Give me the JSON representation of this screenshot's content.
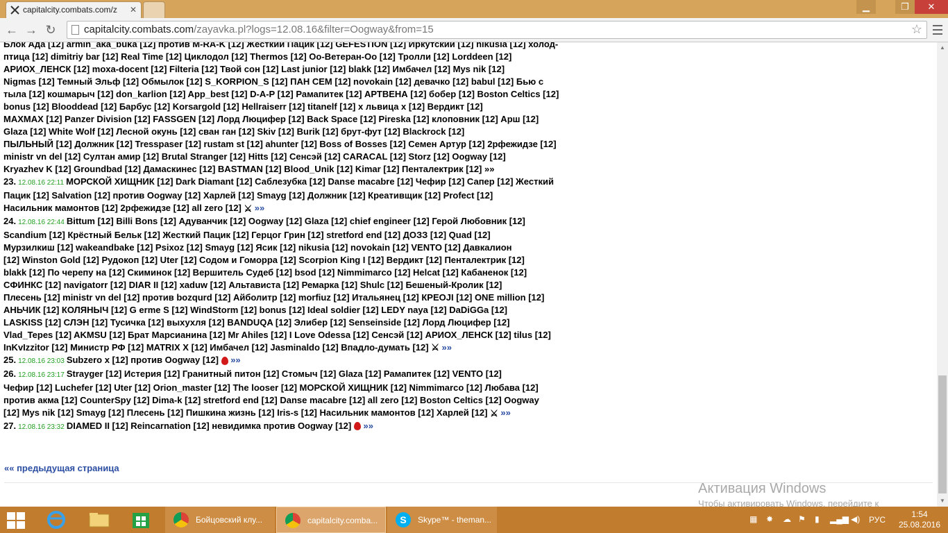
{
  "browser": {
    "tab_title": "capitalcity.combats.com/z",
    "url_host": "capitalcity.combats.com",
    "url_path": "/zayavka.pl?logs=12.08.16&filter=Oogway&from=15"
  },
  "log": {
    "lines": [
      "Блок Ада [12] armin_aka_buka [12] против M-RA-K [12] Жесткий Пацик [12] GEFESTION [12] Иркутский [12] nikusia [12] холод-",
      "птица [12] dimitriy bar [12] Real Time [12] Циклодол [12] Thermos [12] Оо-Ветеран-Оо [12] Тролли [12] Lorddeen [12]",
      "АРИОХ_ЛЕНСК [12] moxa-docent [12] Filteria [12] Твой сон [12] Last junior [12] blakk [12] Имбачел [12] Mys nik [12]",
      "Nigmas [12] Темный Эльф [12] Обмылок [12] S_KORPION_S [12] ПАН СЕМ [12] novokain [12] девачко [12] babul [12] Бью с",
      "тыла [12] кошмарыч [12] don_karlion [12] App_best [12] D-A-P [12] Рамапитек [12] АРТВЕНА [12] бобер [12] Boston Celtics [12]",
      "bonus [12] Blooddead [12] Барбус [12] Korsargold [12] Hellraiserr [12] titanelf [12] х львица х [12] Вердикт [12]",
      "MAXMAX [12] Panzer Division [12] FASSGEN [12] Лорд Люцифер [12] Back Space [12] Pireska [12] клоповник [12] Арш [12]",
      "Glaza [12] White Wolf [12] Лесной окунь [12] сван ган [12] Skiv [12] Burik [12] брут-фут [12] Blackrock [12]",
      "ПЫЛЬНЫЙ [12] Должник [12] Tresspaser [12] rustam st [12] ahunter [12] Boss of Bosses [12] Семен Артур [12] 2рфежидзе [12]",
      "ministr vn del [12] Султан амир [12] Brutal Stranger [12] Hitts [12] Сенсэй [12] CARACAL [12] Storz [12] Oogway [12]",
      "Kryazhev K [12] Groundbad [12] Дамаскинес [12] BASTMAN [12] Blood_Unik [12] Kimar [12] Пенталектрик [12] »»"
    ],
    "entries": [
      {
        "num": "23.",
        "time": "12.08.16 22:11",
        "text1": "МОРСКОЙ ХИЩНИК [12] Dark Diamant [12] Саблезубка [12] Danse macabre [12] Чефир [12] Сапер [12] Жесткий",
        "text2": "Пацик [12] Salvation [12] против Oogway [12] Харлей [12] Smayg [12] Должник [12] Креативщик [12] Profect [12]",
        "text3": "Насильник мамонтов [12] 2рфежидзе [12] all zero [12]",
        "more": "»»"
      },
      {
        "num": "24.",
        "time": "12.08.16 22:44",
        "text1": "Bittum [12] Billi Bons [12] Адуванчик [12] Oogway [12] Glaza [12] chief engineer [12] Герой Любовник [12]",
        "text2": "Scandium [12] Крёстный Бельк [12] Жесткий Пацик [12] Герцог Грин [12] stretford end [12] ДОЗЗ [12] Quad [12]",
        "text3": "Мурзилкиш [12] wakeandbake [12] Psixoz [12] Smayg [12] Ясик [12] nikusia [12] novokain [12] VENTO [12] Давкалион",
        "text4": "[12] Winston Gold [12] Рудокоп [12] Uter [12] Содом и Гоморра [12] Scorpion King I [12] Вердикт [12] Пенталектрик [12]",
        "text5": "blakk [12] По черепу на [12] Скиминок [12] Вершитель Судеб [12] bsod [12] Nimmimarco [12] Helcat [12] Кабаненок [12]",
        "text6": "СФИНКС [12] navigatorr [12] DIAR II [12] xaduw [12] Альтависта [12] Ремарка [12] Shulc [12] Бешеный-Кролик [12]",
        "text7": "Плесень [12] ministr vn del [12] против bozqurd [12] Айболитр [12] morfiuz [12] Итальянец [12] КРЕОJI [12] ONE million [12]",
        "text8": "АНЬЧИК [12] КОЛЯНЫЧ [12] G erme S [12] WindStorm [12] bonus [12] Ideal soldier [12] LEDY naya [12] DaDiGGa [12]",
        "text9": "LASKISS [12] СЛЭН [12] Тусичка [12] выхухля [12] BANDUQA [12] Элибер [12] Senseinside [12] Лорд Люцифер [12]",
        "text10": "Vlad_Tepes [12] AKMSU [12] Брат Марсианина [12] Mr Ahiles [12] I Love Odessa [12] Сенсэй [12] АРИОХ_ЛЕНСК [12] tilus [12]",
        "text11": "InKvIzzitor [12] Министр РФ [12] MATRIX X [12] Имбачел [12] Jasminaldo [12] Впадло-думать [12]",
        "more": "»»"
      },
      {
        "num": "25.",
        "time": "12.08.16 23:03",
        "text1": "Subzero x [12] против Oogway [12]",
        "more": "»»"
      },
      {
        "num": "26.",
        "time": "12.08.16 23:17",
        "text1": "Strayger [12] Истерия [12] Гранитный питон [12] Стомыч [12] Glaza [12] Рамапитек [12] VENTO [12]",
        "text2": "Чефир [12] Luchefer [12] Uter [12] Orion_master [12] The looser [12] МОРСКОЙ ХИЩНИК [12] Nimmimarco [12] Любава [12]",
        "text3": "против акма [12] CounterSpy [12] Dima-k [12] stretford end [12] Danse macabre [12] all zero [12] Boston Celtics [12] Oogway",
        "text4": "[12] Mys nik [12] Smayg [12] Плесень [12] Пишкина жизнь [12] Iris-s [12] Насильник мамонтов [12] Харлей [12]",
        "more": "»»"
      },
      {
        "num": "27.",
        "time": "12.08.16 23:32",
        "text1": "DIAMED II [12] Reincarnation [12] невидимка против Oogway [12]",
        "more": "»»"
      }
    ],
    "prev_page": "«« предыдущая страница"
  },
  "watermark": {
    "title": "Активация Windows",
    "text": "Чтобы активировать Windows, перейдите к параметрам компьютера."
  },
  "taskbar": {
    "items": [
      {
        "label": "Бойцовский клу..."
      },
      {
        "label": "capitalcity.comba..."
      },
      {
        "label": "Skype™ - theman..."
      }
    ],
    "lang": "РУС",
    "time": "1:54",
    "date": "25.08.2016"
  },
  "colors": {
    "titlebar": "#d6a45a",
    "taskbar": "#c27c2e",
    "link": "#2c4ea3",
    "time_green": "#22a022",
    "info_badge": "#1d3e9d"
  }
}
